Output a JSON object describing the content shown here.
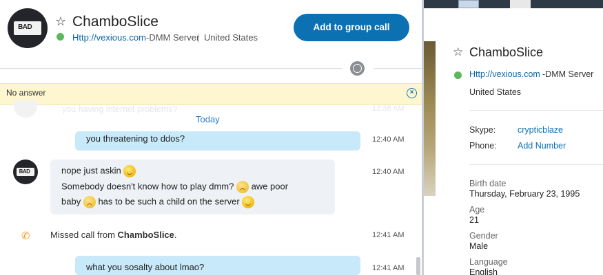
{
  "contact": {
    "name": "ChamboSlice",
    "mood_link": "Http://vexious.com",
    "mood_rest": "-DMM Server",
    "separator": "|",
    "country": "United States",
    "avatar_text": "BAD"
  },
  "header": {
    "add_to_group_call": "Add to group call"
  },
  "notification": {
    "text": "No answer",
    "close_glyph": "×"
  },
  "ghost": {
    "text": "you having internet problems?",
    "time": "12:38 AM"
  },
  "conversation": {
    "day_label": "Today",
    "messages": [
      {
        "direction": "out",
        "text": "you threatening to ddos?",
        "time": "12:40 AM"
      },
      {
        "direction": "in",
        "line1": "nope just askin",
        "line2a": "Somebody doesn't know how to play dmm?",
        "line2b": "awe poor",
        "line3a": "baby",
        "line3b": "has to be such a child on the server",
        "time": "12:40 AM"
      },
      {
        "direction": "system",
        "prefix": "Missed call from ",
        "name": "ChamboSlice",
        "suffix": ".",
        "time": "12:41 AM"
      },
      {
        "direction": "out",
        "text": "what you sosalty about lmao?",
        "time": "12:41 AM"
      }
    ]
  },
  "profile": {
    "name": "ChamboSlice",
    "mood_link": "Http://vexious.com",
    "mood_rest": "-DMM Server",
    "location": "United States",
    "skype_label": "Skype:",
    "skype_value": "crypticblaze",
    "phone_label": "Phone:",
    "phone_value": "Add Number",
    "fields": [
      {
        "label": "Birth date",
        "value": "Thursday, February 23, 1995"
      },
      {
        "label": "Age",
        "value": "21"
      },
      {
        "label": "Gender",
        "value": "Male"
      },
      {
        "label": "Language",
        "value": "English"
      }
    ]
  },
  "icons": {
    "favorite": "star-icon",
    "status": "online-status-icon",
    "globe": "globe-icon",
    "close": "close-icon",
    "phone": "missed-call-icon",
    "emoji_smile": "smile-emoticon-icon",
    "emoji_sad": "sad-emoticon-icon"
  },
  "colors": {
    "accent": "#0b71b3",
    "online": "#5cb85c",
    "bubble_out": "#c7e9f9",
    "bubble_in": "#eef1f5",
    "notification_bg": "#fdf6cf",
    "missed_call": "#f39a1b"
  }
}
